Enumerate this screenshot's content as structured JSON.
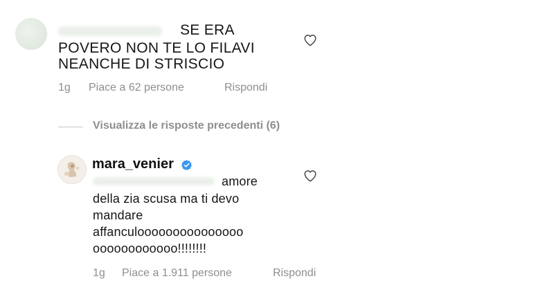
{
  "comment1": {
    "text_lines": [
      "SE ERA",
      "POVERO NON TE LO FILAVI",
      "NEANCHE DI STRISCIO"
    ],
    "time": "1g",
    "likes": "Piace a 62 persone",
    "reply": "Rispondi",
    "like_icon": "heart-outline-icon"
  },
  "view_replies": {
    "label": "Visualizza le risposte precedenti (6)"
  },
  "comment2": {
    "username": "mara_venier",
    "verified_icon": "verified-badge-icon",
    "verified_color": "#3897f0",
    "text_lines": [
      "amore",
      "della zia scusa ma ti devo",
      "mandare",
      "affanculooooooooooooooo",
      "oooooooooooo!!!!!!!!"
    ],
    "time": "1g",
    "likes": "Piace a 1.911 persone",
    "reply": "Rispondi",
    "like_icon": "heart-outline-icon"
  },
  "colors": {
    "text": "#111111",
    "meta": "#8e8e8e",
    "background": "#ffffff"
  }
}
